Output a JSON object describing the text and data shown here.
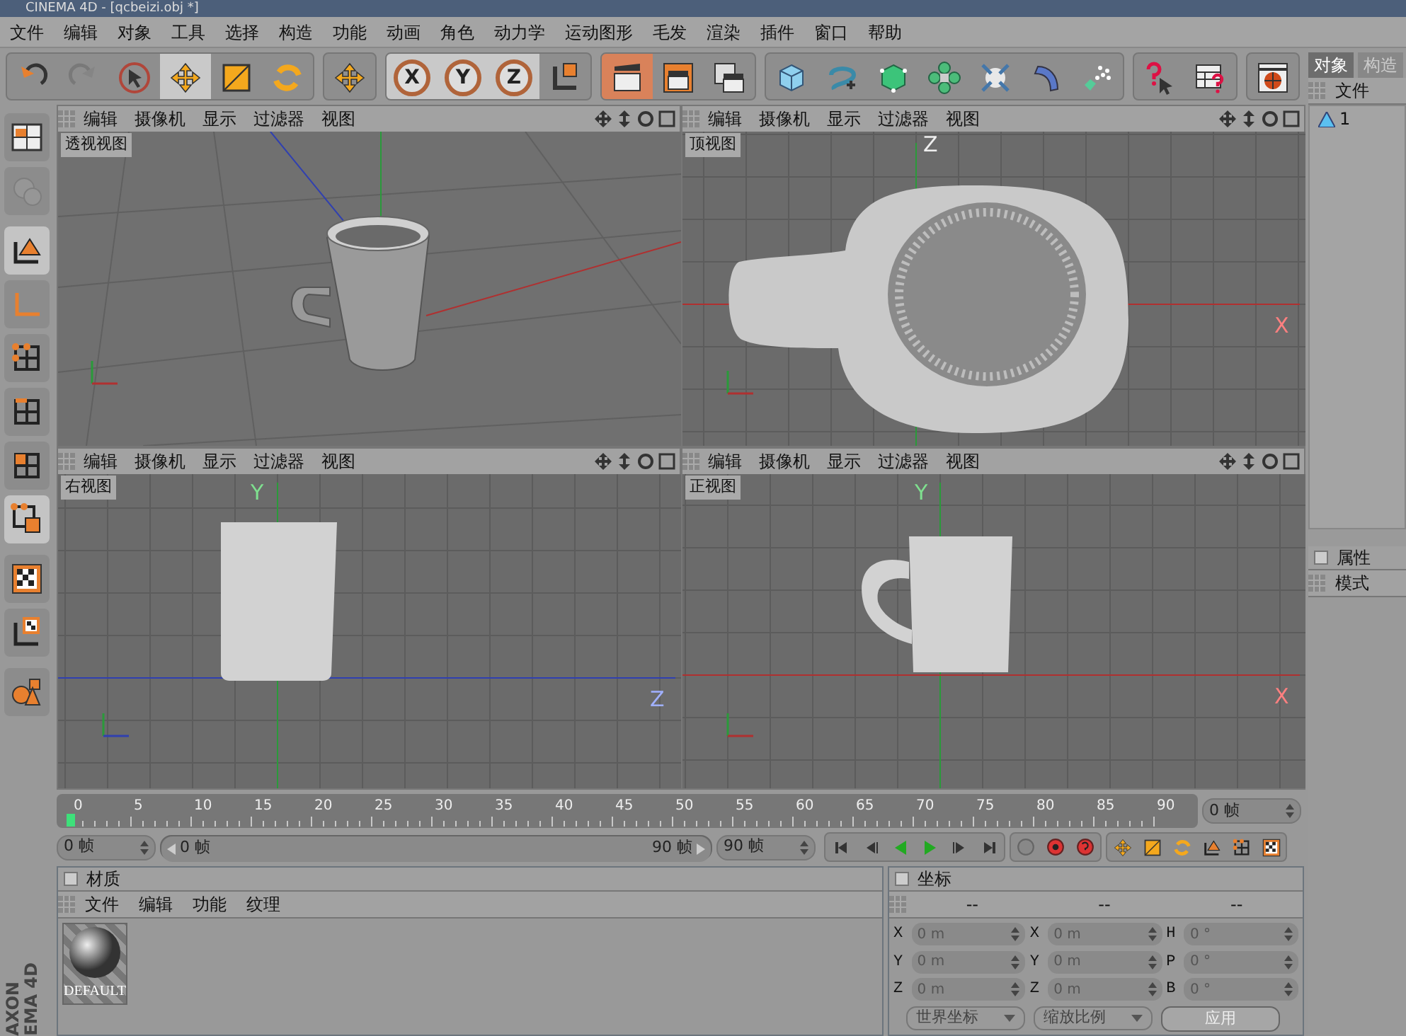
{
  "window": {
    "title": "CINEMA 4D - [qcbeizi.obj *]"
  },
  "menu": [
    "文件",
    "编辑",
    "对象",
    "工具",
    "选择",
    "构造",
    "功能",
    "动画",
    "角色",
    "动力学",
    "运动图形",
    "毛发",
    "渲染",
    "插件",
    "窗口",
    "帮助"
  ],
  "toolbar": [
    {
      "buttons": [
        {
          "kind": "undo",
          "active": false,
          "disabled": false
        },
        {
          "kind": "redo",
          "active": false,
          "disabled": true
        },
        {
          "kind": "select",
          "active": false,
          "disabled": false
        },
        {
          "kind": "move",
          "active": true,
          "disabled": false
        },
        {
          "kind": "scale",
          "active": false,
          "disabled": false
        },
        {
          "kind": "rotate",
          "active": false,
          "disabled": false
        }
      ]
    },
    {
      "buttons": [
        {
          "kind": "move",
          "active": false,
          "disabled": false
        }
      ]
    },
    {
      "buttons": [
        {
          "kind": "axis",
          "label": "X",
          "active": true,
          "disabled": false
        },
        {
          "kind": "axis",
          "label": "Y",
          "active": true,
          "disabled": false
        },
        {
          "kind": "axis",
          "label": "Z",
          "active": true,
          "disabled": false
        },
        {
          "kind": "coords",
          "active": false,
          "disabled": false
        }
      ]
    },
    {
      "buttons": [
        {
          "kind": "clapper",
          "active": true,
          "disabled": false
        },
        {
          "kind": "clapper-frame",
          "active": false,
          "disabled": false
        },
        {
          "kind": "clapper-list",
          "active": false,
          "disabled": false
        }
      ]
    },
    {
      "buttons": [
        {
          "kind": "cube",
          "active": false,
          "disabled": false
        },
        {
          "kind": "spline",
          "active": false,
          "disabled": false
        },
        {
          "kind": "green-cube",
          "active": false,
          "disabled": false
        },
        {
          "kind": "flower",
          "active": false,
          "disabled": false
        },
        {
          "kind": "arrows",
          "active": false,
          "disabled": false
        },
        {
          "kind": "bend",
          "active": false,
          "disabled": false
        },
        {
          "kind": "particles",
          "active": false,
          "disabled": false
        }
      ]
    },
    {
      "buttons": [
        {
          "kind": "help-cursor",
          "active": false,
          "disabled": false
        },
        {
          "kind": "help-table",
          "active": false,
          "disabled": false
        }
      ]
    },
    {
      "buttons": [
        {
          "kind": "globe",
          "active": false,
          "disabled": false
        }
      ]
    }
  ],
  "left_tools": [
    {
      "kind": "layout",
      "active": false,
      "disabled": false
    },
    {
      "kind": "camera",
      "active": false,
      "disabled": true
    },
    {
      "kind": "model",
      "active": true,
      "disabled": false
    },
    {
      "kind": "object-axis",
      "active": false,
      "disabled": false
    },
    {
      "kind": "points",
      "active": false,
      "disabled": false
    },
    {
      "kind": "edges",
      "active": false,
      "disabled": false
    },
    {
      "kind": "polygons",
      "active": false,
      "disabled": false
    },
    {
      "kind": "uv-points",
      "active": true,
      "disabled": false
    },
    {
      "kind": "texture",
      "active": false,
      "disabled": false
    },
    {
      "kind": "texture-axis",
      "active": false,
      "disabled": false
    },
    {
      "kind": "primitives",
      "active": false,
      "disabled": false
    }
  ],
  "logo_lines": [
    "AXON",
    "EMA 4D"
  ],
  "viewports": [
    {
      "kind": "perspective",
      "label": "透视视图",
      "menu": [
        "编辑",
        "摄像机",
        "显示",
        "过滤器",
        "视图"
      ]
    },
    {
      "kind": "top",
      "label": "顶视图",
      "menu": [
        "编辑",
        "摄像机",
        "显示",
        "过滤器",
        "视图"
      ],
      "axis_labels": [
        "Z",
        "X"
      ]
    },
    {
      "kind": "right",
      "label": "右视图",
      "menu": [
        "编辑",
        "摄像机",
        "显示",
        "过滤器",
        "视图"
      ],
      "axis_labels": [
        "Y",
        "Z"
      ]
    },
    {
      "kind": "front",
      "label": "正视图",
      "menu": [
        "编辑",
        "摄像机",
        "显示",
        "过滤器",
        "视图"
      ],
      "axis_labels": [
        "Y",
        "X"
      ]
    }
  ],
  "timeline": {
    "ticks": [
      "0",
      "5",
      "10",
      "15",
      "20",
      "25",
      "30",
      "35",
      "40",
      "45",
      "50",
      "55",
      "60",
      "65",
      "70",
      "75",
      "80",
      "85",
      "90"
    ],
    "level": 0,
    "frame_field": "0 帧"
  },
  "playback": {
    "start_field": "0 帧",
    "range_start": "0 帧",
    "range_end": "90 帧",
    "level": 1,
    "end_field": "90 帧"
  },
  "objects_panel": {
    "tabs": [
      {
        "label": "对象",
        "selected": true
      },
      {
        "label": "构造",
        "selected": false
      }
    ],
    "menu": [
      "文件"
    ],
    "items": [
      {
        "name": "1"
      }
    ]
  },
  "attributes_panel": {
    "title": "属性",
    "checked": false,
    "menu": [
      "模式"
    ]
  },
  "material_panel": {
    "title": "材质",
    "checked": false,
    "menu": [
      "文件",
      "编辑",
      "功能",
      "纹理"
    ],
    "materials": [
      {
        "name": "DEFAULT"
      }
    ]
  },
  "coordinates_panel": {
    "title": "坐标",
    "checked": false,
    "headers": [
      "--",
      "--",
      "--"
    ],
    "rows": [
      {
        "fields": [
          {
            "label": "X",
            "value": "0 m"
          },
          {
            "label": "X",
            "value": "0 m"
          },
          {
            "label": "H",
            "value": "0 °"
          }
        ]
      },
      {
        "fields": [
          {
            "label": "Y",
            "value": "0 m"
          },
          {
            "label": "Y",
            "value": "0 m"
          },
          {
            "label": "P",
            "value": "0 °"
          }
        ]
      },
      {
        "fields": [
          {
            "label": "Z",
            "value": "0 m"
          },
          {
            "label": "Z",
            "value": "0 m"
          },
          {
            "label": "B",
            "value": "0 °"
          }
        ]
      }
    ],
    "dropdowns": [
      "世界坐标",
      "缩放比例"
    ],
    "apply": "应用"
  }
}
